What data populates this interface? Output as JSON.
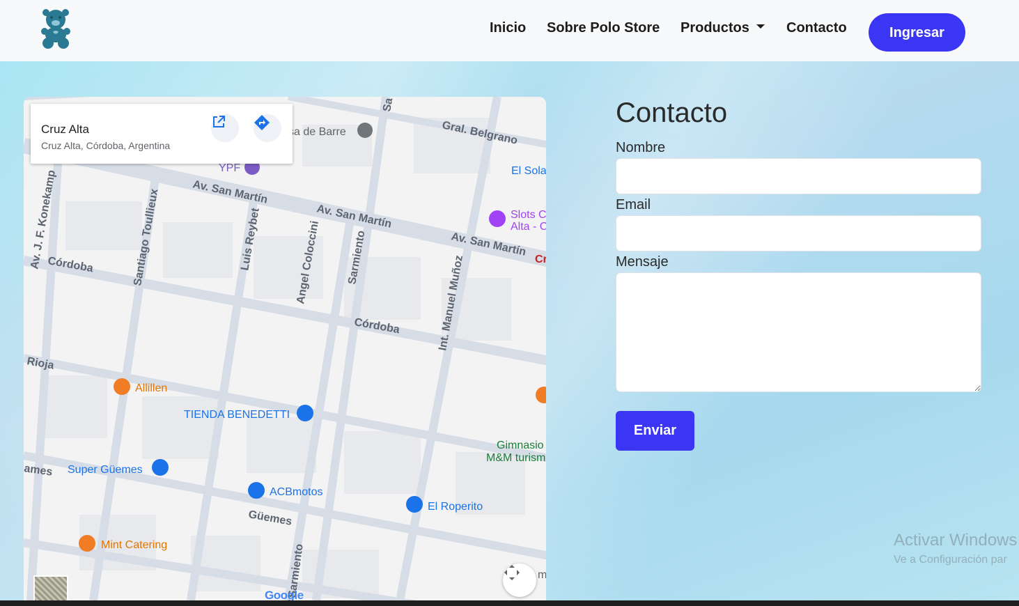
{
  "nav": {
    "links": [
      "Inicio",
      "Sobre Polo Store",
      "Productos",
      "Contacto"
    ],
    "login_label": "Ingresar"
  },
  "map": {
    "card_title": "Cruz Alta",
    "card_subtitle": "Cruz Alta, Córdoba, Argentina",
    "streets": [
      "Av. San Martín",
      "Av. San Martín",
      "Av. San Martín",
      "Córdoba",
      "Córdoba",
      "Rioja",
      "Güemes",
      "Gral. Belgrano",
      "Santiago Toullieux",
      "Luis Reybet",
      "Angel Coloccini",
      "Sarmiento",
      "Sarmiento",
      "Int. Manuel Muñoz",
      "Av. J. F. Konekamp",
      "ames",
      "Sa"
    ],
    "places": {
      "casa_de_barre": "sa de Barre",
      "ypf": "YPF",
      "el_solar": "El Sola",
      "slots_1": "Slots C",
      "slots_2": "Alta - C",
      "allillen": "Allillen",
      "tienda": "TIENDA BENEDETTI",
      "super_guemes": "Super Güemes",
      "acbmotos": "ACBmotos",
      "el_roperito": "El Roperito",
      "gimnasio_1": "Gimnasio",
      "gimnasio_2": "M&M turism",
      "mint_catering": "Mint Catering",
      "cruz_partial": "Cr",
      "m_partial": "m"
    },
    "google": "Google"
  },
  "form": {
    "title": "Contacto",
    "name_label": "Nombre",
    "email_label": "Email",
    "message_label": "Mensaje",
    "submit_label": "Enviar"
  },
  "watermark": {
    "line1": "Activar Windows",
    "line2": "Ve a Configuración par"
  },
  "colors": {
    "brand": "#3b36f3",
    "logo": "#2b7a93",
    "background": "#9fdcef"
  }
}
